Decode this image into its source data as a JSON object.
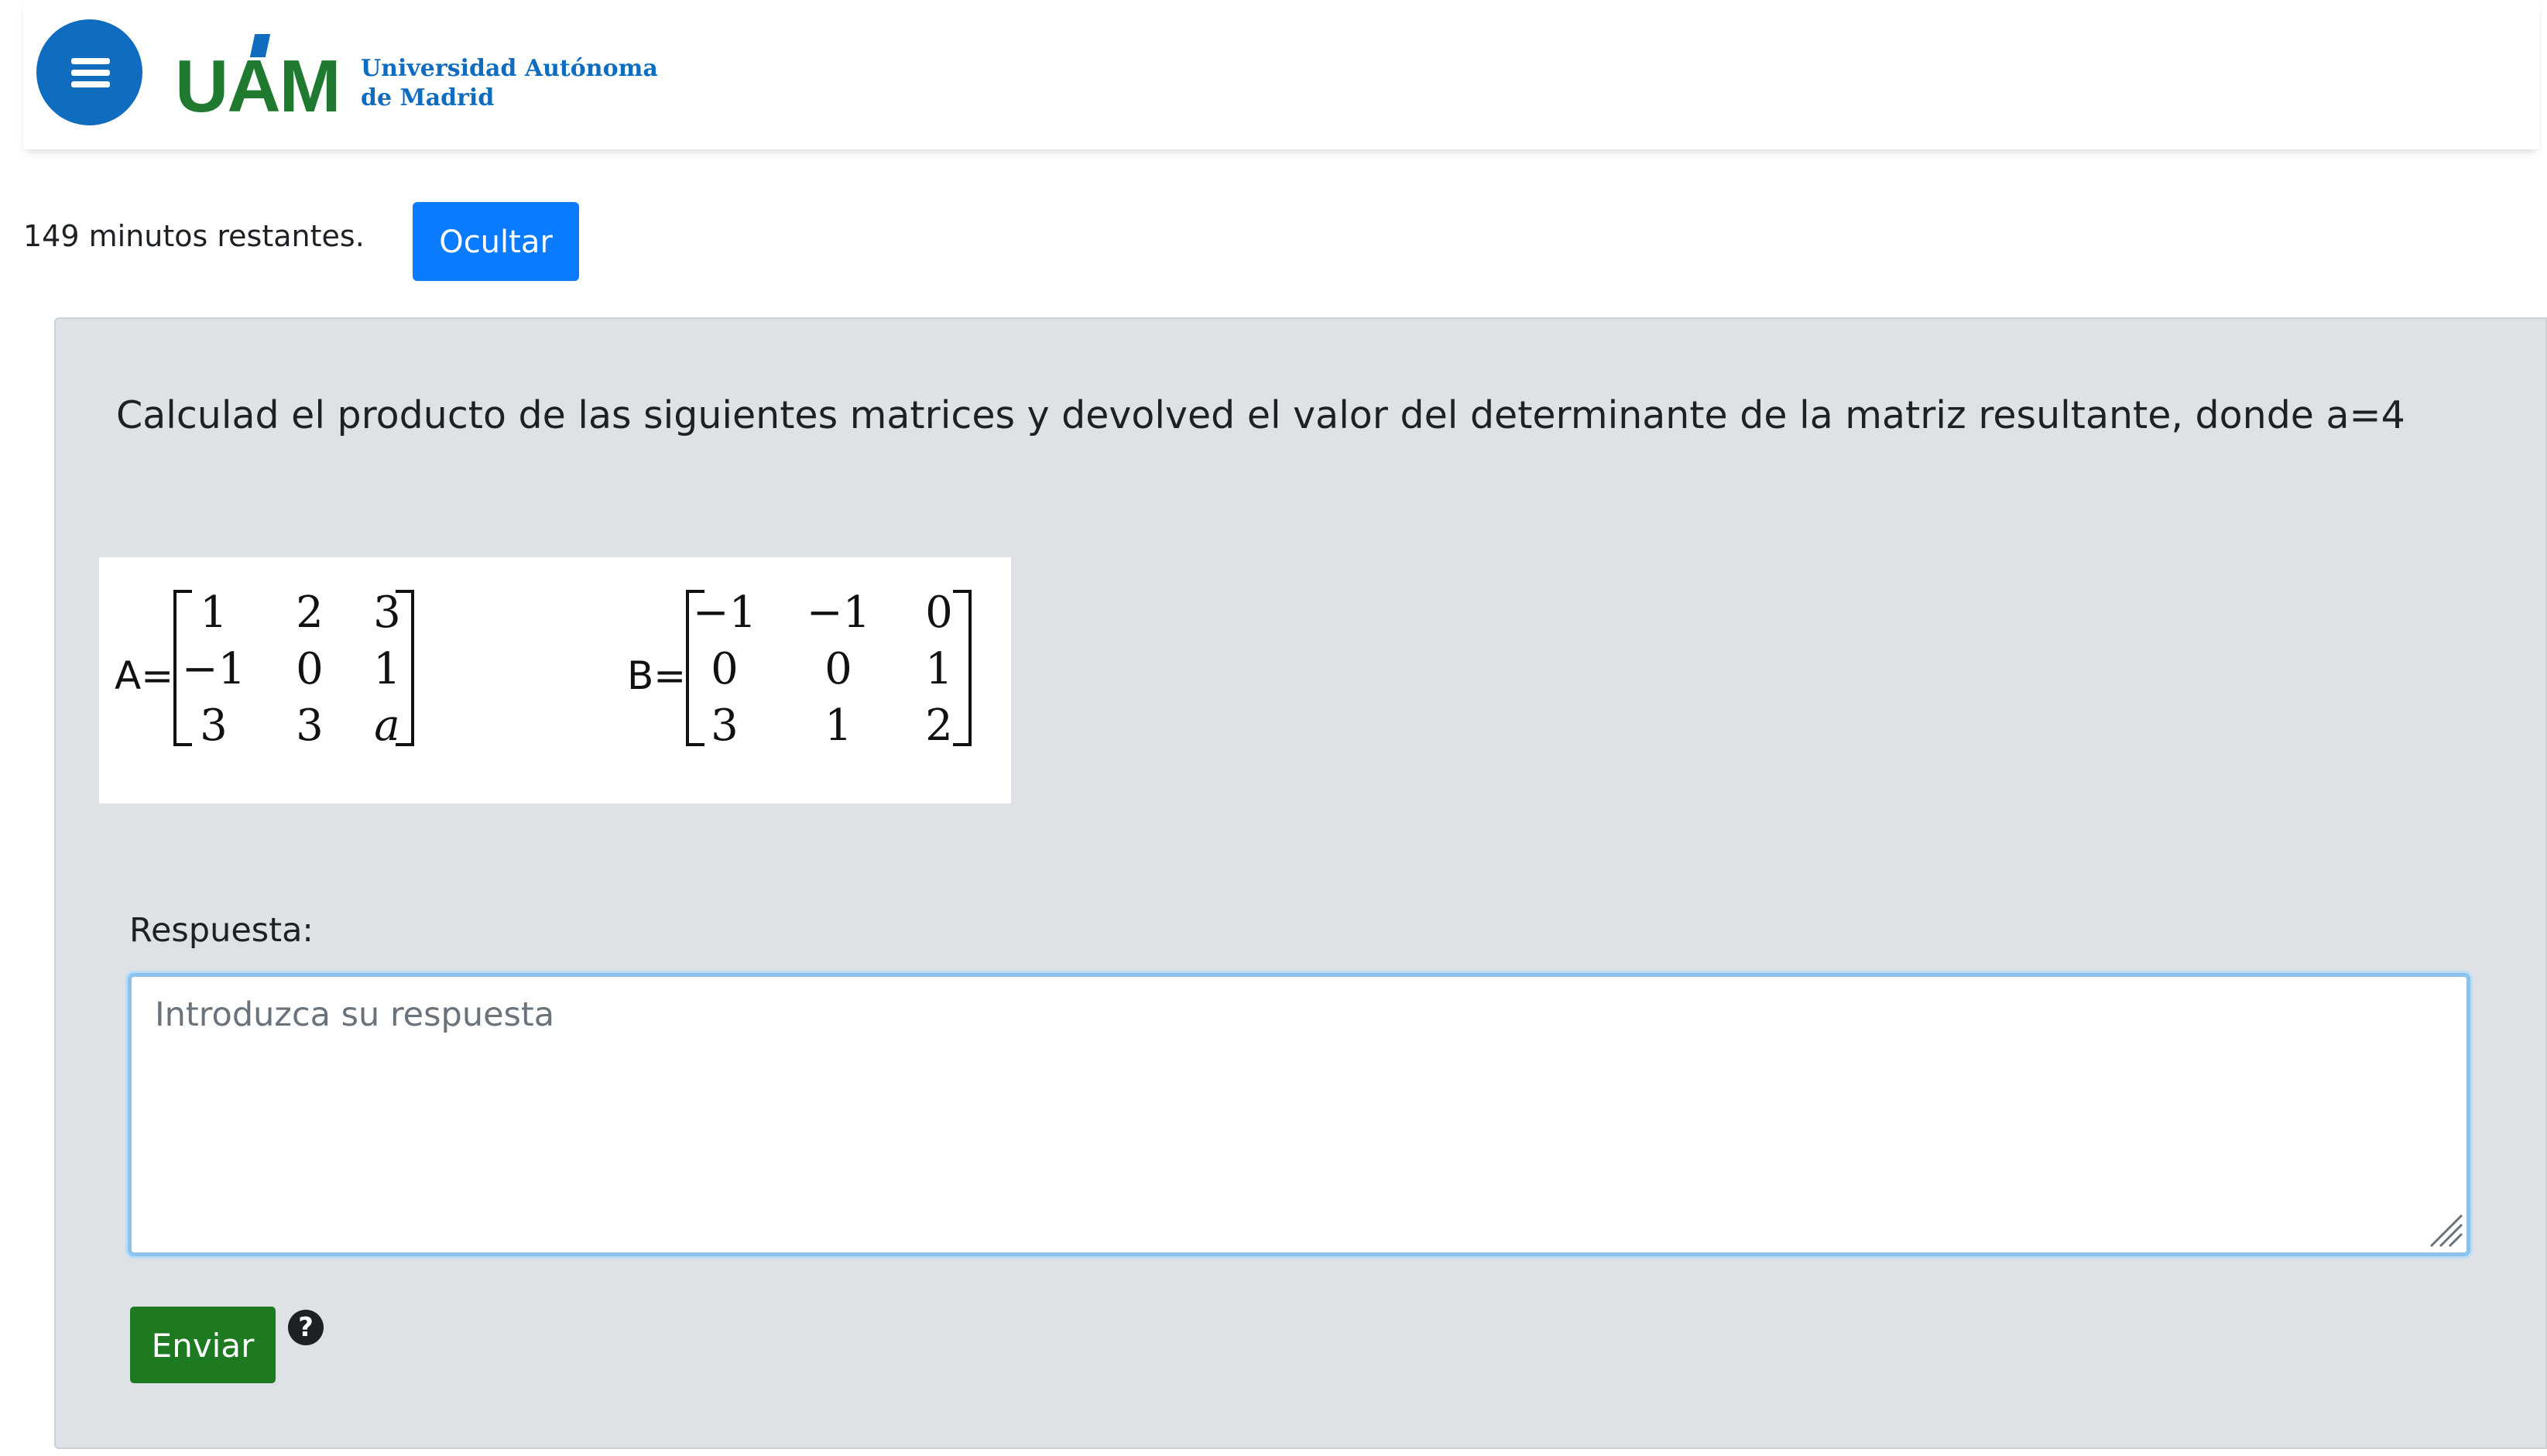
{
  "header": {
    "menu_icon": "hamburger-menu-icon",
    "logo_mark": "UAM",
    "logo_line1": "Universidad Autónoma",
    "logo_line2": "de Madrid",
    "brand_blue": "#0f6cbf",
    "brand_green": "#1f7a30"
  },
  "timer": {
    "text": "149 minutos restantes.",
    "hide_label": "Ocultar"
  },
  "question": {
    "text": "Calculad el producto de las siguientes matrices y devolved el valor del determinante de la matriz resultante, donde a=4",
    "matrix_a": {
      "label": "A=",
      "rows": [
        [
          "1",
          "2",
          "3"
        ],
        [
          "−1",
          "0",
          "1"
        ],
        [
          "3",
          "3",
          "a"
        ]
      ]
    },
    "matrix_b": {
      "label": "B=",
      "rows": [
        [
          "−1",
          "−1",
          "0"
        ],
        [
          "0",
          "0",
          "1"
        ],
        [
          "3",
          "1",
          "2"
        ]
      ]
    }
  },
  "answer": {
    "label": "Respuesta:",
    "placeholder": "Introduzca su respuesta",
    "value": ""
  },
  "actions": {
    "submit_label": "Enviar",
    "submit_color": "#1e7a21",
    "help_icon": "question-circle-icon",
    "help_glyph": "?"
  }
}
